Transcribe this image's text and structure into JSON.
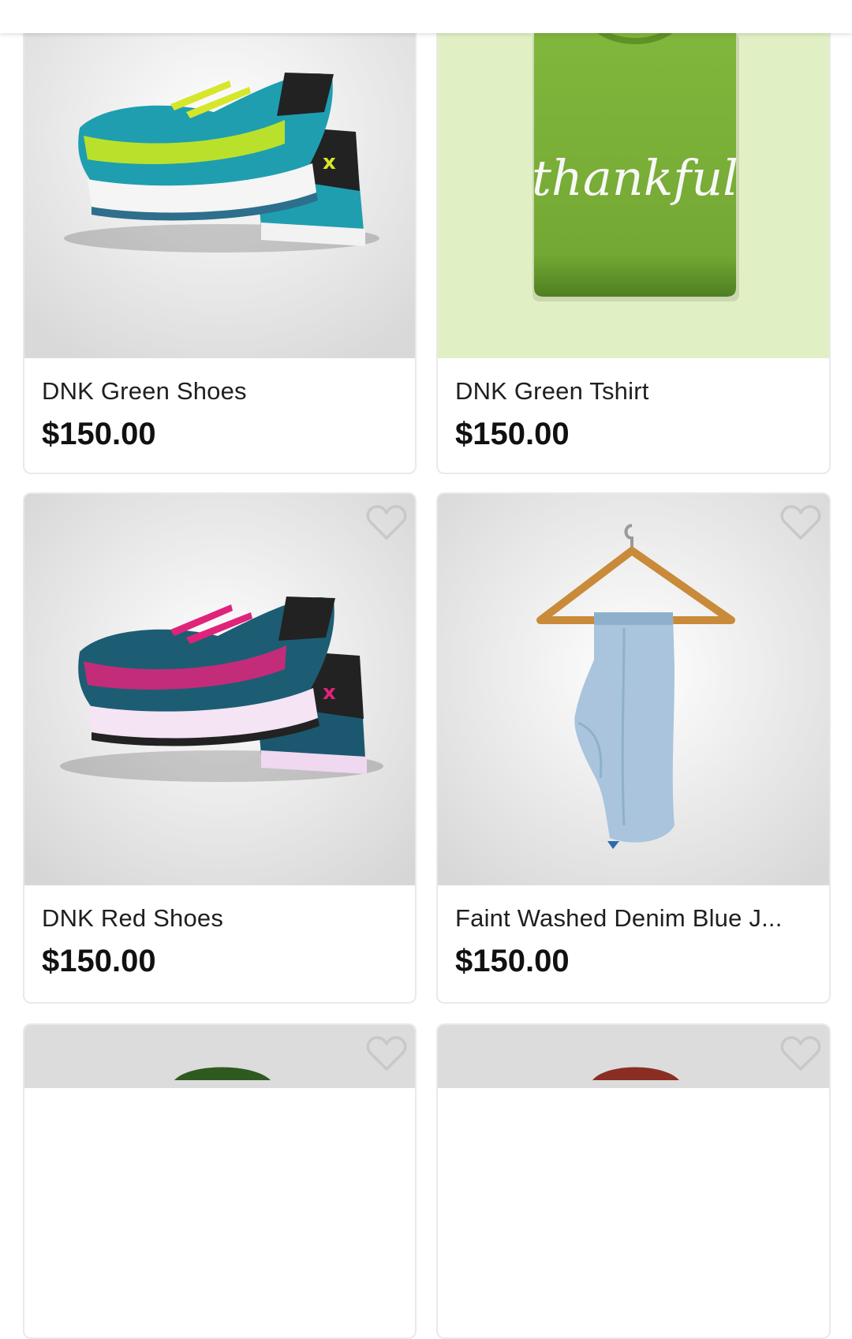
{
  "products": [
    {
      "name": "DNK Green Shoes",
      "price": "$150.00"
    },
    {
      "name": "DNK Green Tshirt",
      "price": "$150.00",
      "shirt_text": "thankful"
    },
    {
      "name": "DNK Red Shoes",
      "price": "$150.00"
    },
    {
      "name": "Faint Washed Denim Blue J...",
      "price": "$150.00"
    }
  ],
  "icons": {
    "favorite": "heart-outline-icon"
  },
  "colors": {
    "card_border": "#e9e9e9",
    "text_primary": "#1f1f1f",
    "price": "#111111",
    "favorite_outline": "#c8c8c8",
    "tshirt_bg": "#e1f0c4",
    "tshirt": "#7fb33a",
    "shoe_green": "#1f9eb0",
    "shoe_accent_green": "#b9e12b",
    "shoe_red_body": "#1d5d73",
    "shoe_accent_pink": "#e0237a"
  }
}
